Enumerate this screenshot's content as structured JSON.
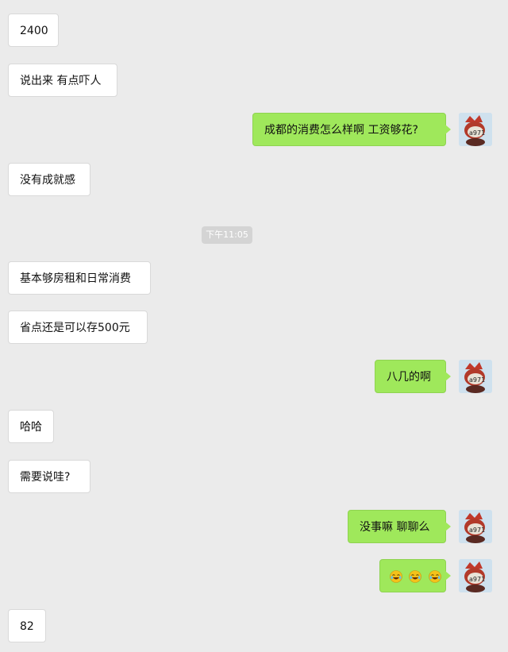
{
  "chat": {
    "messages": [
      {
        "id": "m1",
        "side": "in",
        "text": "2400"
      },
      {
        "id": "m2",
        "side": "in",
        "text": "说出来 有点吓人"
      },
      {
        "id": "m3",
        "side": "out",
        "text": "成都的消费怎么样啊 工资够花?"
      },
      {
        "id": "m4",
        "side": "in",
        "text": "没有成就感"
      },
      {
        "id": "m5",
        "side": "in",
        "text": "基本够房租和日常消费"
      },
      {
        "id": "m6",
        "side": "in",
        "text": "省点还是可以存500元"
      },
      {
        "id": "m7",
        "side": "out",
        "text": "八几的啊"
      },
      {
        "id": "m8",
        "side": "in",
        "text": "哈哈"
      },
      {
        "id": "m9",
        "side": "in",
        "text": "需要说哇?"
      },
      {
        "id": "m10",
        "side": "out",
        "text": "没事嘛 聊聊么"
      },
      {
        "id": "m11",
        "side": "out",
        "emoji": [
          "laughing-crying-emoji",
          "laughing-crying-emoji",
          "laughing-crying-emoji"
        ]
      },
      {
        "id": "m12",
        "side": "in",
        "text": "82"
      }
    ],
    "timestamp": "下午11:05"
  },
  "colors": {
    "background": "#ebebeb",
    "incoming_bubble": "#ffffff",
    "outgoing_bubble": "#9fe85b",
    "timestamp_bg": "#d4d4d4"
  },
  "avatar": {
    "icon": "cartoon-avatar-icon"
  }
}
